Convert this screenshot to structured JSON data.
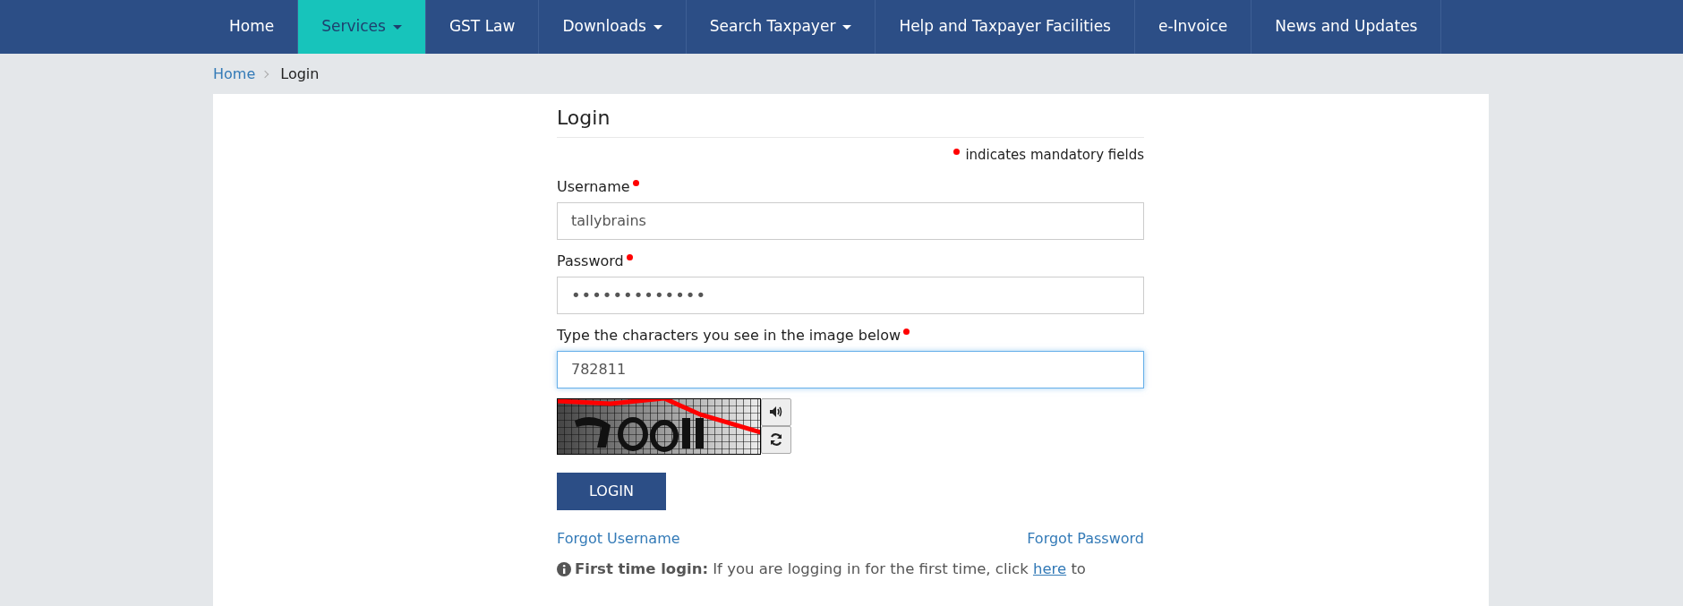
{
  "nav": [
    {
      "label": "Home",
      "dropdown": false,
      "selected": false
    },
    {
      "label": "Services",
      "dropdown": true,
      "selected": true
    },
    {
      "label": "GST Law",
      "dropdown": false,
      "selected": false
    },
    {
      "label": "Downloads",
      "dropdown": true,
      "selected": false
    },
    {
      "label": "Search Taxpayer",
      "dropdown": true,
      "selected": false
    },
    {
      "label": "Help and Taxpayer Facilities",
      "dropdown": false,
      "selected": false
    },
    {
      "label": "e-Invoice",
      "dropdown": false,
      "selected": false
    },
    {
      "label": "News and Updates",
      "dropdown": false,
      "selected": false
    }
  ],
  "breadcrumb": [
    "Home",
    "Login"
  ],
  "form": {
    "title": "Login",
    "mandatory_note": "indicates mandatory fields",
    "fields": [
      {
        "label": "Username",
        "value": "tallybrains",
        "kind": "text",
        "required": true,
        "focused": false
      },
      {
        "label": "Password",
        "value": "•••••••••••••",
        "kind": "password",
        "required": true,
        "focused": false
      },
      {
        "label": "Type the characters you see in the image below",
        "value": "782811",
        "kind": "text",
        "required": true,
        "focused": true
      }
    ],
    "captcha": {
      "kind": "picture"
    },
    "submit": "LOGIN",
    "links": [
      "Forgot Username",
      "Forgot Password"
    ],
    "note": {
      "label": "First time login:",
      "text": "If you are logging in for the first time, click",
      "link": "here",
      "after": "to"
    }
  }
}
